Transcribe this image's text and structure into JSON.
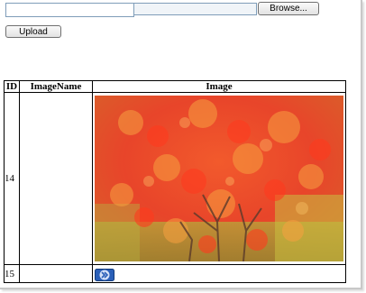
{
  "form": {
    "text_value": "",
    "file_value": "",
    "browse_label": "Browse...",
    "upload_label": "Upload"
  },
  "table": {
    "headers": [
      "ID",
      "ImageName",
      "Image"
    ],
    "rows": [
      {
        "id": "14",
        "image_name": "",
        "image": "autumn-maple-tree-photo"
      },
      {
        "id": "15",
        "image_name": "",
        "image": "broken-image-icon"
      }
    ]
  },
  "colors": {
    "input_border": "#7f9db9",
    "foliage_red": "#e8452a",
    "foliage_orange": "#f07a2a",
    "foliage_yellow": "#c8c040"
  }
}
